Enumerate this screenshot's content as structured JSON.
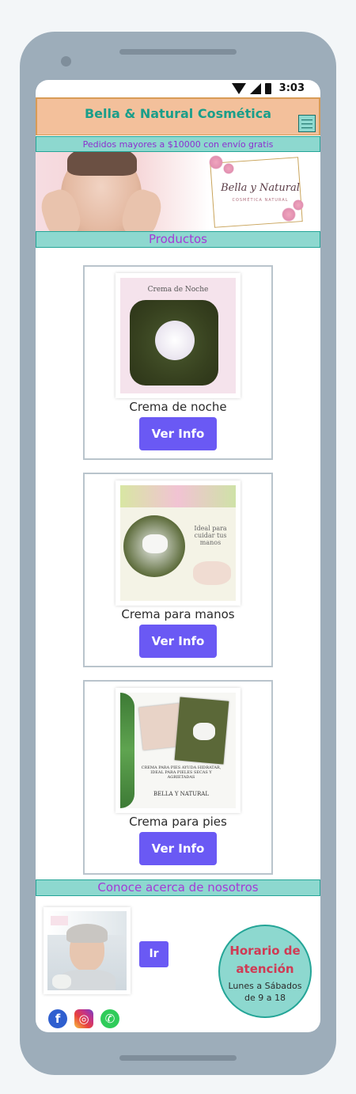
{
  "status_bar": {
    "time": "3:03"
  },
  "header": {
    "brand": "Bella & Natural Cosmética",
    "menu_icon": "hamburger-menu-icon"
  },
  "promo": {
    "text": "Pedidos mayores a $10000 con envío gratis"
  },
  "banner": {
    "title": "Bella y Natural",
    "subtitle": "COSMÉTICA NATURAL"
  },
  "products": {
    "title": "Productos",
    "items": [
      {
        "name": "Crema de noche",
        "button": "Ver Info",
        "image_caption": "Crema de Noche"
      },
      {
        "name": "Crema para manos",
        "button": "Ver Info",
        "image_caption": "Ideal para cuidar tus manos"
      },
      {
        "name": "Crema para pies",
        "button": "Ver Info",
        "image_caption": "CREMA PARA PIES AYUDA HIDRATAR, IDEAL PARA PIELES SECAS Y AGRIETADAS",
        "image_brand": "BELLA Y NATURAL"
      }
    ]
  },
  "about": {
    "title": "Conoce acerca de nosotros",
    "button": "Ir"
  },
  "hours": {
    "title_line1": "Horario de",
    "title_line2": "atención",
    "days": "Lunes a Sábados",
    "time": "de 9 a 18"
  },
  "socials": {
    "facebook": "f",
    "instagram": "◎",
    "whatsapp": "✆"
  },
  "colors": {
    "accent_teal": "#8dd8cf",
    "header_bg": "#f3c09b",
    "button_purple": "#6a59f4",
    "brand_text": "#1a9e8a",
    "section_text": "#a43ad6",
    "hours_text": "#d03a54"
  }
}
